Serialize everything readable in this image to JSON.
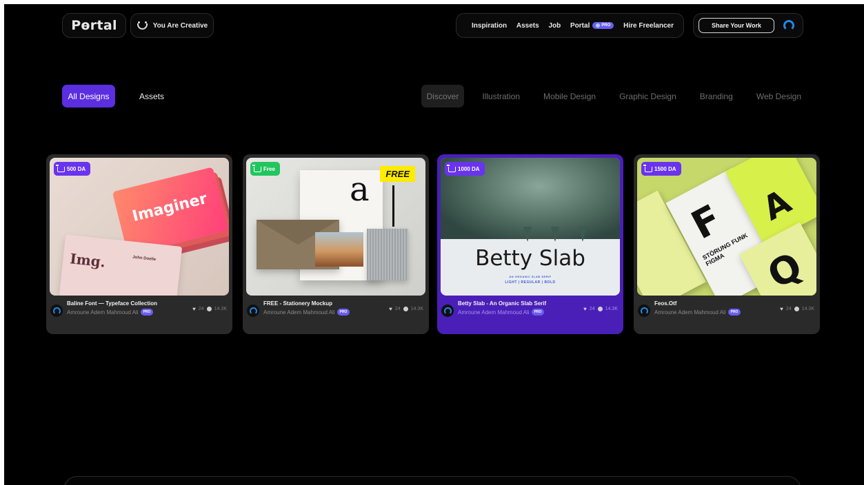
{
  "header": {
    "logo": "Pөrtal",
    "tagline": "You Are Creative",
    "nav": [
      "Inspiration",
      "Assets",
      "Job",
      "Portal",
      "Hire Freelancer"
    ],
    "pro_badge": "PRO",
    "share_label": "Share Your Work"
  },
  "segments": {
    "all": "All Designs",
    "assets": "Assets"
  },
  "categories": [
    "Discover",
    "Illustration",
    "Mobile Design",
    "Graphic Design",
    "Branding",
    "Web Design"
  ],
  "cards": [
    {
      "price": "500 DA",
      "title": "Baline Font — Typeface Collection",
      "author": "Amroune Adem Mahmoud Ali",
      "likes": "24",
      "views": "14.3K",
      "art_text": [
        "Imaginer",
        "Img.",
        "John Doelle"
      ]
    },
    {
      "price": "Free",
      "title": "FREE - Stationery Mockup",
      "author": "Amroune Adem Mahmoud Ali",
      "likes": "24",
      "views": "14.3K",
      "art_text": [
        "FREE",
        "a"
      ]
    },
    {
      "price": "1000 DA",
      "title": "Betty Slab - An Organic Slab Serif",
      "author": "Amroune Adem Mahmoud Ali",
      "likes": "24",
      "views": "14.3K",
      "art_text": [
        "Betty Slab",
        "AN ORGANIC SLAB SERIF",
        "LIGHT | REGULAR | BOLD"
      ]
    },
    {
      "price": "1500 DA",
      "title": "Feos.Otf",
      "author": "Amroune Adem Mahmoud Ali",
      "likes": "24",
      "views": "14.3K",
      "art_text": [
        "F",
        "STÖRUNG FUNK FIGMA",
        "A",
        "Q"
      ]
    }
  ],
  "colors": {
    "accent": "#5b2ee0",
    "highlight_card": "#4a1fb8",
    "free": "#22c55e",
    "pro": "#6b5cf0",
    "avatar": "#1e88e5"
  }
}
